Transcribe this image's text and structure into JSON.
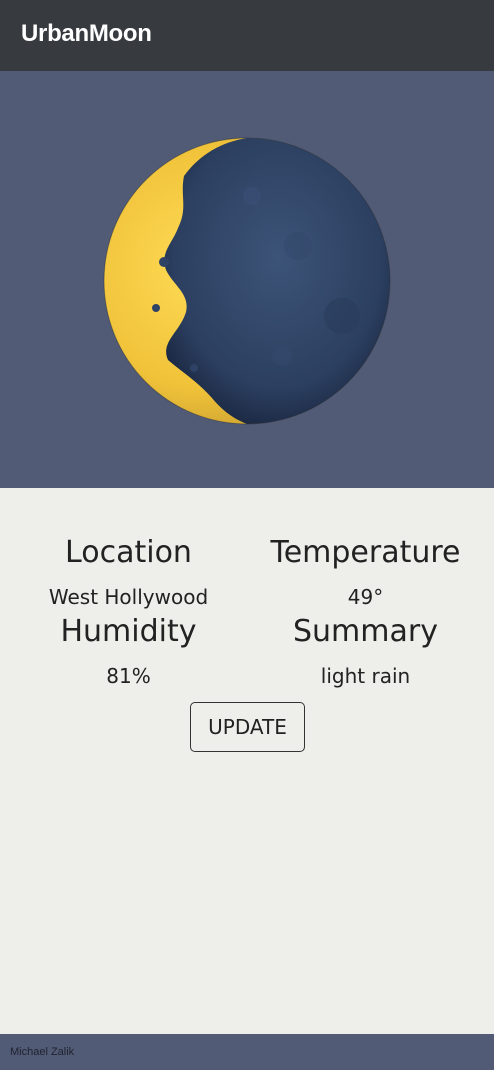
{
  "header": {
    "app_title": "UrbanMoon"
  },
  "hero": {
    "image": "waxing-crescent-moon"
  },
  "weather": {
    "location": {
      "label": "Location",
      "value": "West Hollywood"
    },
    "temperature": {
      "label": "Temperature",
      "value": "49°"
    },
    "humidity": {
      "label": "Humidity",
      "value": "81%"
    },
    "summary": {
      "label": "Summary",
      "value": "light rain"
    }
  },
  "actions": {
    "update_label": "UPDATE"
  },
  "footer": {
    "author": "Michael Zalik"
  },
  "colors": {
    "topbar": "#373a3f",
    "hero_bg": "#525b75",
    "content_bg": "#eeefea",
    "moon_lit": "#f2c43a",
    "moon_dark": "#2e4266"
  }
}
